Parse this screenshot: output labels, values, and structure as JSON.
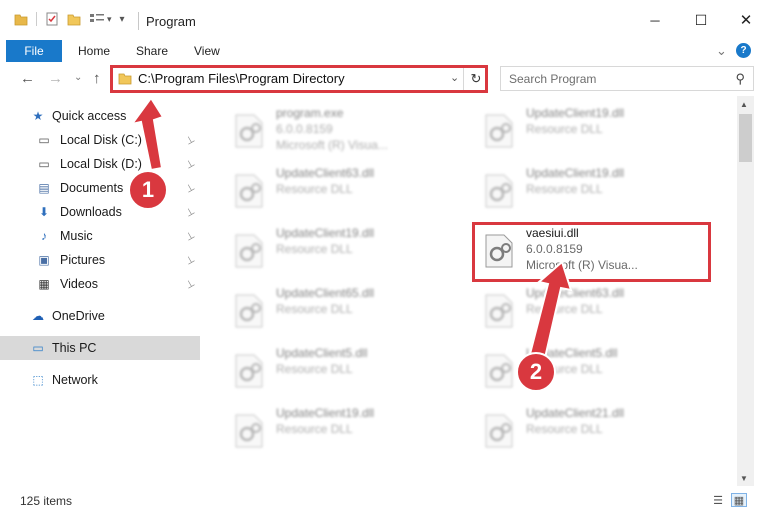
{
  "window": {
    "title": "Program",
    "minimize_glyph": "─",
    "maximize_glyph": "☐",
    "close_glyph": "✕"
  },
  "ribbon": {
    "tabs": [
      "File",
      "Home",
      "Share",
      "View"
    ],
    "expand_glyph": "⌄",
    "help_glyph": "?"
  },
  "address": {
    "path": "C:\\Program Files\\Program Directory",
    "dropdown_glyph": "⌄",
    "refresh_glyph": "↻"
  },
  "search": {
    "placeholder": "Search Program",
    "icon_glyph": "⚲"
  },
  "nav": {
    "back_glyph": "←",
    "forward_glyph": "→",
    "recent_glyph": "⌄",
    "up_glyph": "↑"
  },
  "sidebar": {
    "items": [
      {
        "label": "Quick access",
        "icon": "star-icon",
        "glyph": "★",
        "color": "#2f6fbd"
      },
      {
        "label": "Local Disk (C:)",
        "icon": "drive-icon",
        "glyph": "▭",
        "color": "#555555",
        "pinned": true
      },
      {
        "label": "Local Disk (D:)",
        "icon": "drive-icon",
        "glyph": "▭",
        "color": "#555555",
        "pinned": true
      },
      {
        "label": "Documents",
        "icon": "documents-icon",
        "glyph": "▤",
        "color": "#4a6fa5",
        "pinned": true
      },
      {
        "label": "Downloads",
        "icon": "downloads-icon",
        "glyph": "⬇",
        "color": "#2f6fbd",
        "pinned": true
      },
      {
        "label": "Music",
        "icon": "music-icon",
        "glyph": "♪",
        "color": "#2f6fbd",
        "pinned": true
      },
      {
        "label": "Pictures",
        "icon": "pictures-icon",
        "glyph": "▣",
        "color": "#4a6fa5",
        "pinned": true
      },
      {
        "label": "Videos",
        "icon": "videos-icon",
        "glyph": "▦",
        "color": "#333333",
        "pinned": true
      },
      {
        "label": "OneDrive",
        "icon": "onedrive-icon",
        "glyph": "☁",
        "color": "#1e5fb4"
      },
      {
        "label": "This PC",
        "icon": "this-pc-icon",
        "glyph": "▭",
        "color": "#2f7fc9",
        "selected": true
      },
      {
        "label": "Network",
        "icon": "network-icon",
        "glyph": "⬚",
        "color": "#2f7fc9"
      }
    ],
    "pin_glyph": "📌"
  },
  "files": {
    "left": [
      {
        "name": "program.exe",
        "line2": "6.0.0.8159",
        "line3": "Microsoft (R) Visua..."
      },
      {
        "name": "UpdateClient63.dll",
        "line2": "Resource DLL"
      },
      {
        "name": "UpdateClient19.dll",
        "line2": "Resource DLL"
      },
      {
        "name": "UpdateClient65.dll",
        "line2": "Resource DLL"
      },
      {
        "name": "UpdateClient5.dll",
        "line2": "Resource DLL"
      },
      {
        "name": "UpdateClient19.dll",
        "line2": "Resource DLL"
      }
    ],
    "right": [
      {
        "name": "UpdateClient19.dll",
        "line2": "Resource DLL"
      },
      {
        "name": "UpdateClient19.dll",
        "line2": "Resource DLL"
      },
      {
        "name": "vaesiui.dll",
        "line2": "6.0.0.8159",
        "line3": "Microsoft (R) Visua...",
        "highlighted": true
      },
      {
        "name": "UpdateClient63.dll",
        "line2": "Resource DLL"
      },
      {
        "name": "UpdateClient5.dll",
        "line2": "Resource DLL"
      },
      {
        "name": "UpdateClient21.dll",
        "line2": "Resource DLL"
      }
    ]
  },
  "status": {
    "item_count": "125 items"
  },
  "annotations": {
    "badge1": "1",
    "badge2": "2",
    "color": "#d9383f"
  }
}
